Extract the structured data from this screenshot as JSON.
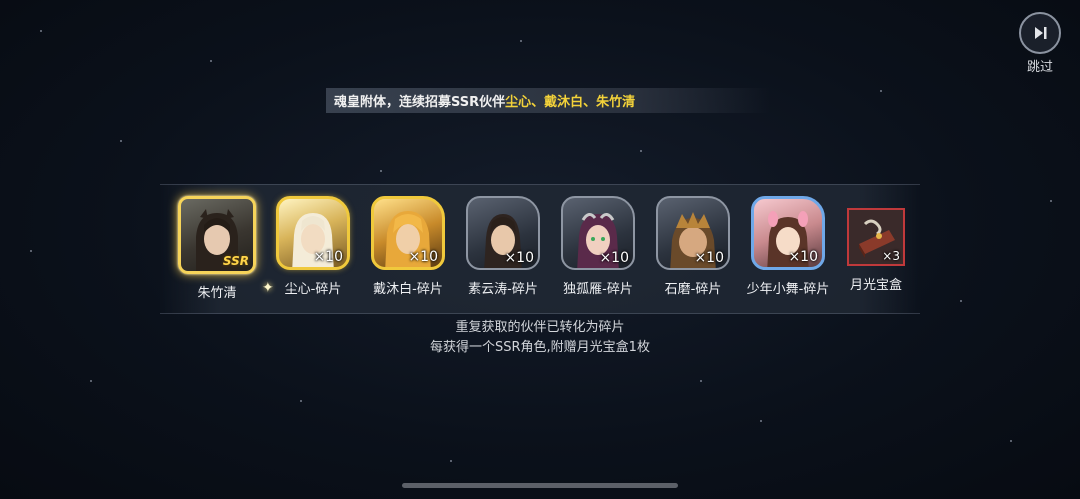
{
  "skip": {
    "label": "跳过",
    "icon": "skip-forward-icon"
  },
  "banner": {
    "prefix": "魂皇附体，连续招募SSR伙伴",
    "highlight": "尘心、戴沐白、朱竹清"
  },
  "rewards": [
    {
      "name": "朱竹清",
      "frame": "ssr",
      "badge": "SSR",
      "qty": ""
    },
    {
      "name": "尘心-碎片",
      "frame": "gold",
      "badge": "",
      "qty": "×10"
    },
    {
      "name": "戴沐白-碎片",
      "frame": "gold2",
      "badge": "",
      "qty": "×10"
    },
    {
      "name": "素云涛-碎片",
      "frame": "grey",
      "badge": "",
      "qty": "×10"
    },
    {
      "name": "独孤雁-碎片",
      "frame": "grey",
      "badge": "",
      "qty": "×10"
    },
    {
      "name": "石磨-碎片",
      "frame": "grey",
      "badge": "",
      "qty": "×10"
    },
    {
      "name": "少年小舞-碎片",
      "frame": "blue",
      "badge": "",
      "qty": "×10"
    },
    {
      "name": "月光宝盒",
      "frame": "item",
      "badge": "",
      "qty": "×3"
    }
  ],
  "notes": {
    "line1": "重复获取的伙伴已转化为碎片",
    "line2": "每获得一个SSR角色,附赠月光宝盒1枚"
  },
  "colors": {
    "gold": "#f0c93c",
    "ssr_text": "#ffd54a",
    "highlight": "#f3d23a",
    "blue_frame": "#6fa8e8",
    "item_frame": "#c0393b"
  }
}
